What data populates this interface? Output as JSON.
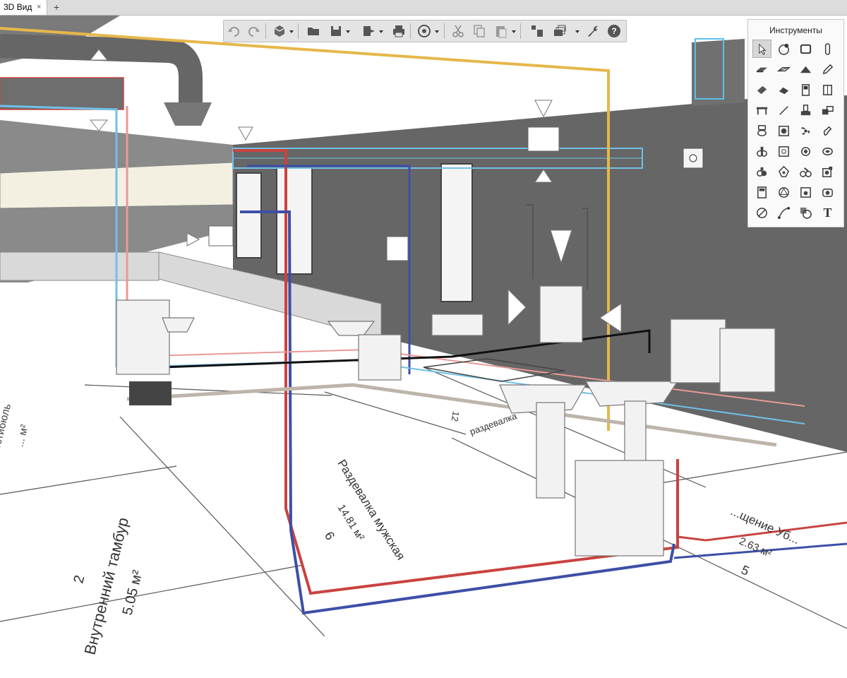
{
  "tabs": [
    {
      "label": "3D Вид",
      "close": "×"
    }
  ],
  "tab_add": "+",
  "toolbar": {
    "buttons": [
      "undo-icon",
      "redo-icon",
      "view-3d-icon",
      "open-folder-icon",
      "save-icon",
      "export-icon",
      "print-icon",
      "render-settings-icon",
      "cut-icon",
      "copy-icon",
      "paste-icon",
      "properties-icon",
      "layers-icon",
      "wrench-icon",
      "help-icon"
    ]
  },
  "tools_panel": {
    "title": "Инструменты",
    "items": [
      "cursor-tool-icon",
      "node-tool-icon",
      "wall-tool-icon",
      "column-tool-icon",
      "slab-tool-icon",
      "floor-tool-icon",
      "roof-tool-icon",
      "pencil-tool-icon",
      "beam-tool-icon",
      "stair-tool-icon",
      "door-tool-icon",
      "window-tool-icon",
      "table-tool-icon",
      "line-tool-icon",
      "pipe-fitting-tool-icon",
      "duct-fitting-tool-icon",
      "toilet-tool-icon",
      "boiler-tool-icon",
      "fan-tool-icon",
      "valve-tool-icon",
      "pump-tool-icon",
      "heater-tool-icon",
      "radiator-tool-icon",
      "tank-tool-icon",
      "filter-tool-icon",
      "lamp-tool-icon",
      "mixer-tool-icon",
      "socket-tool-icon",
      "cabinet-tool-icon",
      "gear-tool-icon",
      "meter-tool-icon",
      "camera-tool-icon",
      "measure-tool-icon",
      "route-tool-icon",
      "hatch-tool-icon",
      "text-tool-icon"
    ],
    "text_tool": "T"
  },
  "rooms": {
    "r1": {
      "name": "Внутренний тамбур",
      "number": "2",
      "area": "5.05 м²"
    },
    "r2": {
      "name": "Раздевалка мужская",
      "number": "6",
      "area": "14.81 м²"
    },
    "r3": {
      "number": "5",
      "area": "2.63 м²",
      "name": "...щение Уб..."
    },
    "r4": {
      "name": "Вестибюль",
      "area": "... м²"
    },
    "r5": {
      "text": "12"
    },
    "r6": {
      "text": "раздевалка"
    }
  },
  "colors": {
    "hot_water": "#c9433e",
    "cold_water": "#6fc1e8",
    "return": "#3d4fa6",
    "gas": "#e6b74a",
    "wall": "#6c6c6c",
    "floor": "#ffffff"
  }
}
